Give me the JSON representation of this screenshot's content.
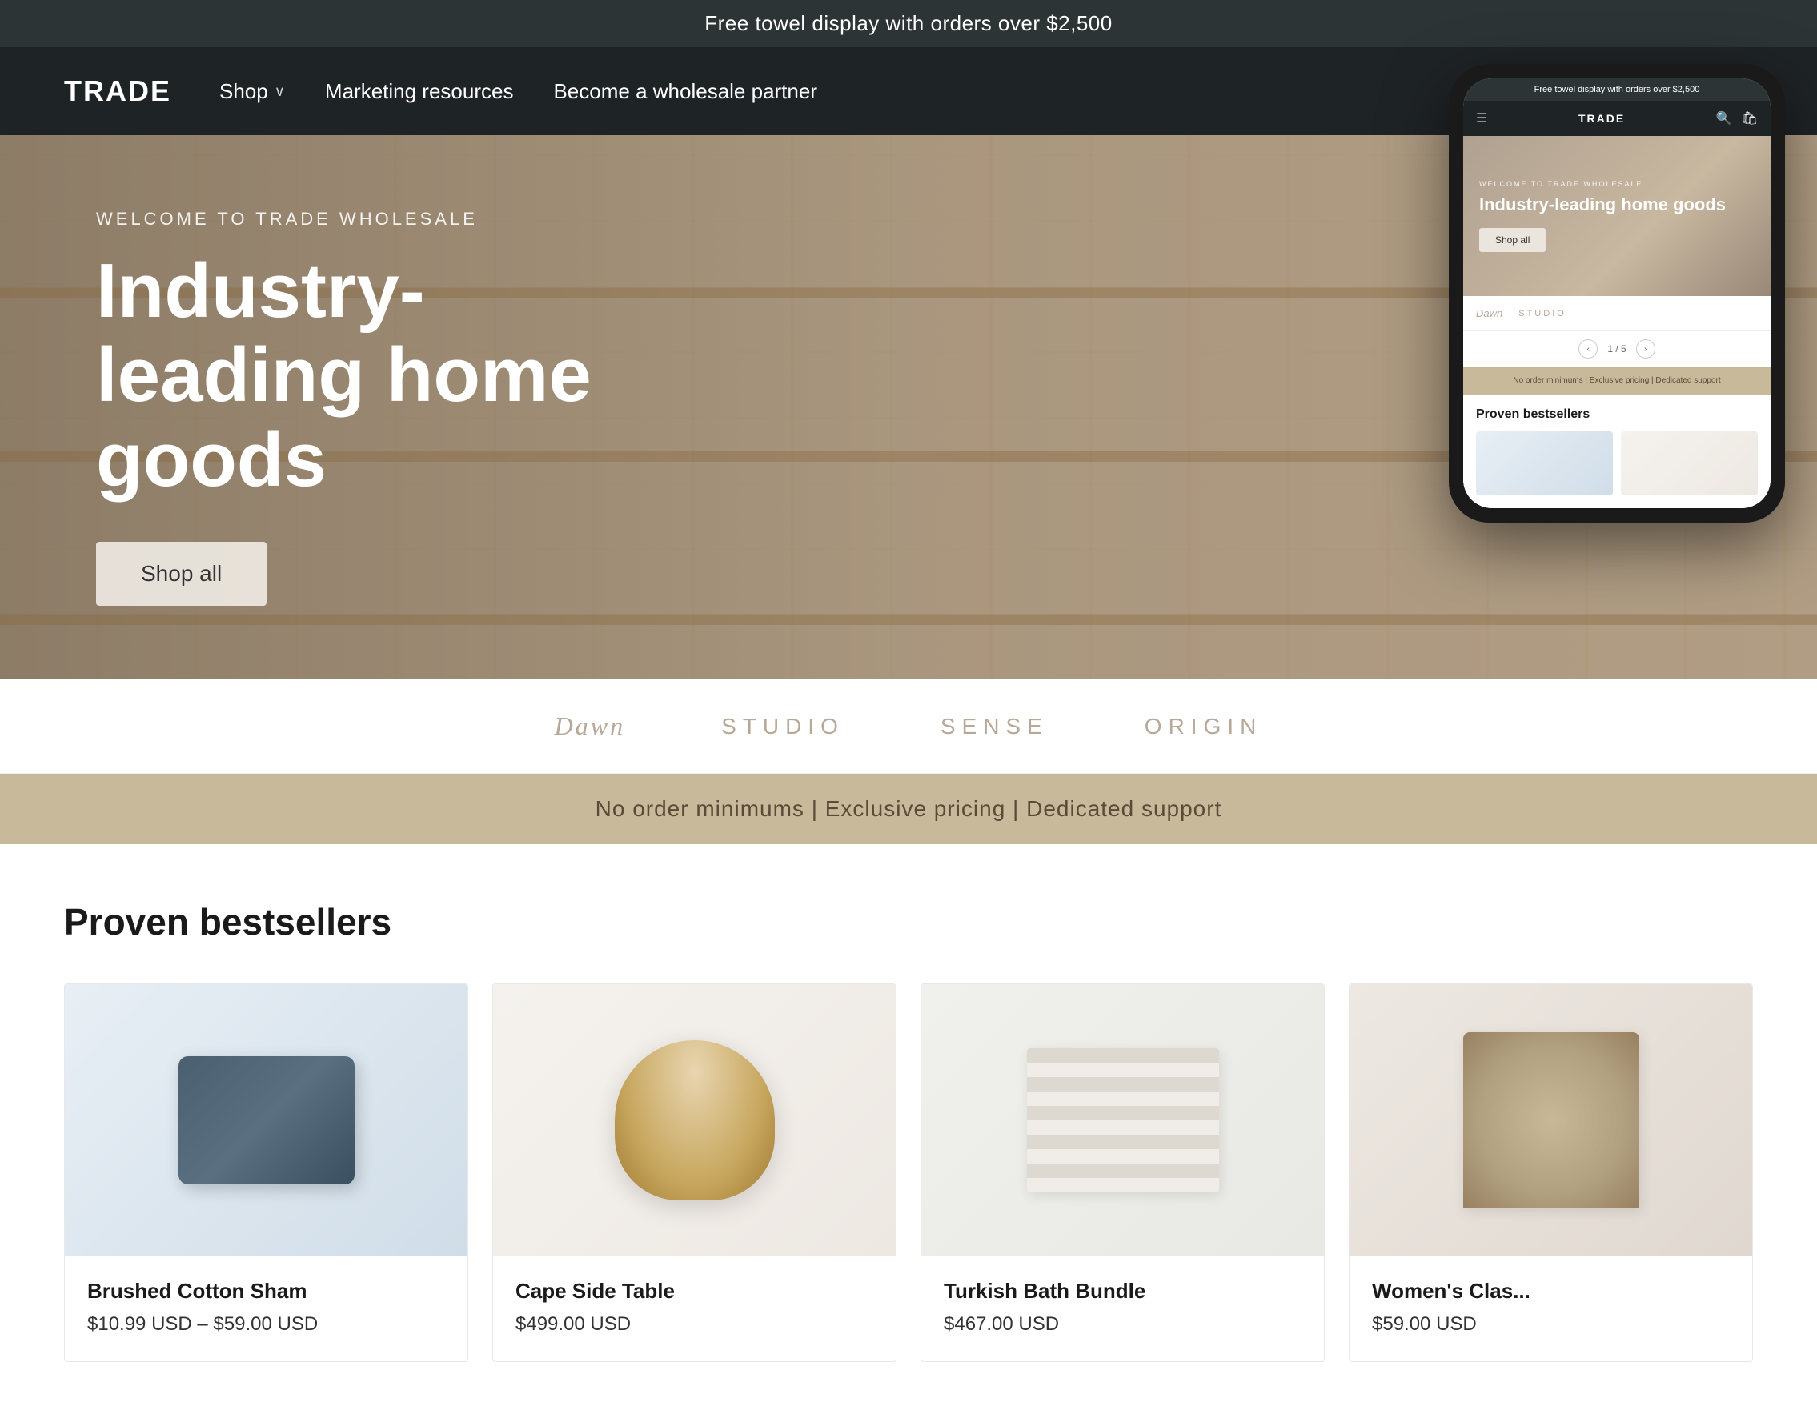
{
  "announcement": {
    "text": "Free towel display with orders over $2,500"
  },
  "header": {
    "logo": "TRADE",
    "nav": [
      {
        "label": "Shop",
        "hasDropdown": true
      },
      {
        "label": "Marketing resources",
        "hasDropdown": false
      },
      {
        "label": "Become a wholesale partner",
        "hasDropdown": false
      }
    ]
  },
  "hero": {
    "subtitle": "WELCOME TO TRADE WHOLESALE",
    "title": "Industry-leading home goods",
    "cta": "Shop all"
  },
  "brands": [
    {
      "label": "Dawn",
      "style": "serif"
    },
    {
      "label": "STUDIO",
      "style": "spaced"
    },
    {
      "label": "SENSE",
      "style": "spaced"
    },
    {
      "label": "ORIGIN",
      "style": "spaced"
    }
  ],
  "value_bar": {
    "text": "No order minimums | Exclusive pricing | Dedicated support"
  },
  "bestsellers": {
    "section_title": "Proven bestsellers",
    "products": [
      {
        "name": "Brushed Cotton Sham",
        "price": "$10.99 USD – $59.00 USD",
        "image_type": "pillow"
      },
      {
        "name": "Cape Side Table",
        "price": "$499.00 USD",
        "image_type": "table"
      },
      {
        "name": "Turkish Bath Bundle",
        "price": "$467.00 USD",
        "image_type": "towels"
      },
      {
        "name": "Women's Clas...",
        "price": "$59.00 USD",
        "image_type": "clothing"
      }
    ]
  },
  "mobile": {
    "announcement": "Free towel display with orders over $2,500",
    "logo": "TRADE",
    "hero_subtitle": "WELCOME TO TRADE WHOLESALE",
    "hero_title": "Industry-leading home goods",
    "hero_cta": "Shop all",
    "brands": [
      "Dawn",
      "STUDIO"
    ],
    "carousel": "1 / 5",
    "value_bar": "No order minimums | Exclusive pricing | Dedicated support",
    "section_title": "Proven bestsellers"
  },
  "icons": {
    "account": "👤",
    "cart": "🛍",
    "chevron_down": "∨",
    "search": "🔍",
    "hamburger": "☰",
    "arrow_left": "‹",
    "arrow_right": "›"
  }
}
